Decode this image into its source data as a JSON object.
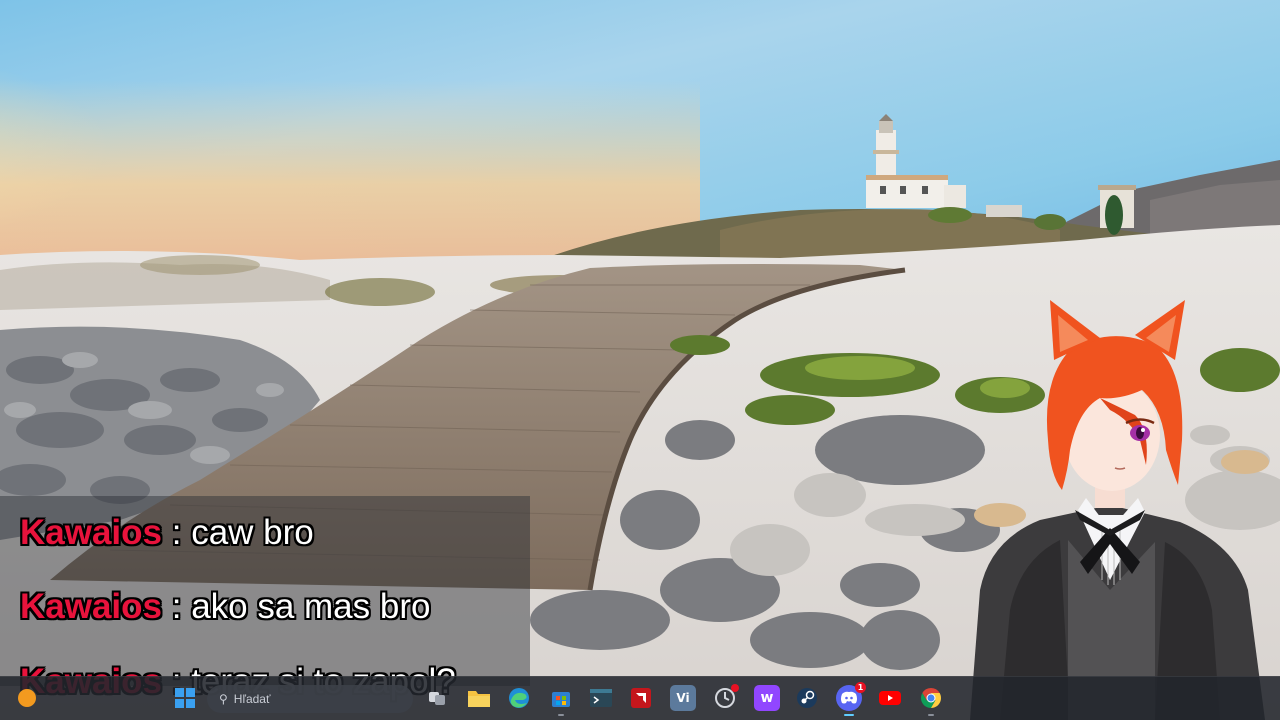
{
  "taskbar": {
    "search_placeholder": "Hľadať",
    "app_labels": {
      "visual_studio": "Vi",
      "twitch": "w"
    },
    "discord_badge": "1"
  },
  "chat": {
    "messages": [
      {
        "user": "Kawaios",
        "separator": " : ",
        "text": "caw bro"
      },
      {
        "user": "Kawaios",
        "separator": " : ",
        "text": "ako sa mas bro"
      },
      {
        "user": "Kawaios",
        "separator": " : ",
        "text": "teraz si to zapol?"
      }
    ],
    "colors": {
      "username": "#e8133c",
      "text": "#ffffff"
    }
  },
  "icons": [
    "windows-start-icon",
    "search-icon",
    "task-view-icon",
    "file-explorer-icon",
    "edge-icon",
    "microsoft-store-icon",
    "terminal-icon",
    "amd-software-icon",
    "visual-studio-icon",
    "clock-app-icon",
    "twitch-icon",
    "steam-icon",
    "discord-icon",
    "youtube-icon",
    "chrome-icon"
  ]
}
